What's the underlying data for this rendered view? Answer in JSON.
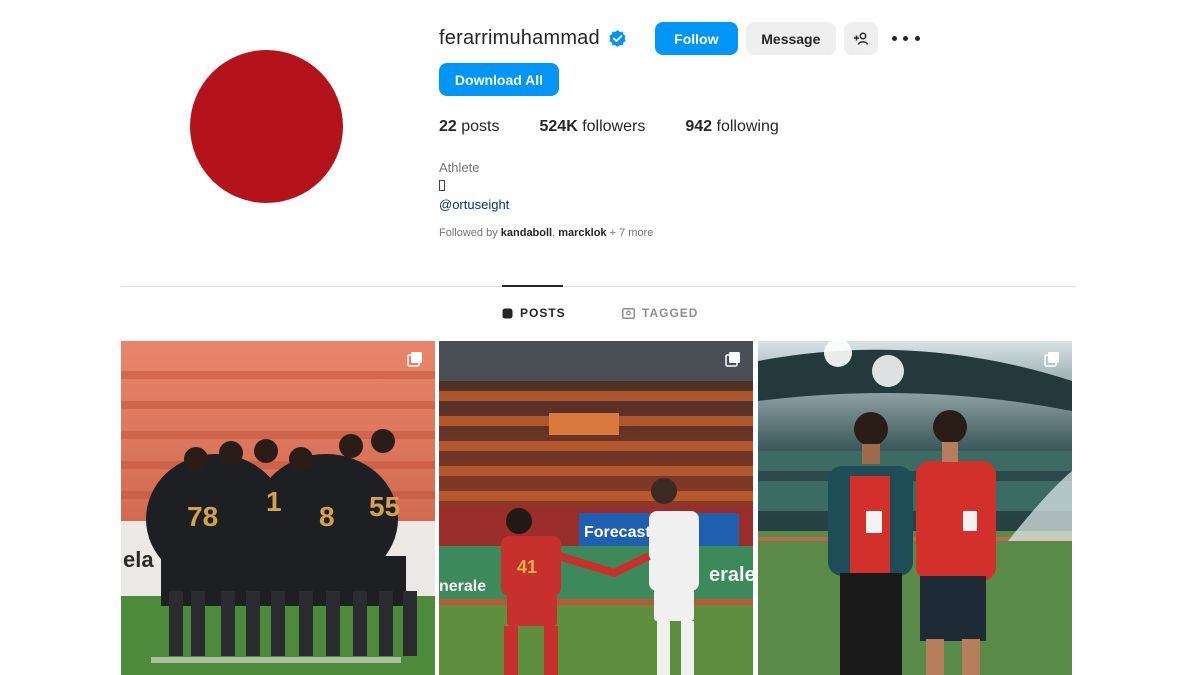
{
  "profile": {
    "username": "ferarrimuhammad",
    "verified_icon": "verified-badge-icon",
    "follow_label": "Follow",
    "message_label": "Message",
    "suggest_icon": "add-person-icon",
    "more_icon": "more-options-icon",
    "download_label": "Download All",
    "posts_count": "22",
    "posts_label": "posts",
    "followers_count": "524K",
    "followers_label": "followers",
    "following_count": "942",
    "following_label": "following",
    "bio_category": "Athlete",
    "bio_link": "@ortuseight",
    "followed_by_prefix": "Followed by",
    "followed_by_user1": "kandaboll",
    "followed_by_sep": ",",
    "followed_by_user2": "marcklok",
    "followed_by_more": "+ 7 more",
    "avatar_color": "#b5131c",
    "accent_color": "#0095f6"
  },
  "tabs": [
    {
      "label": "POSTS",
      "icon": "grid-icon",
      "active": true
    },
    {
      "label": "TAGGED",
      "icon": "tag-icon",
      "active": false
    }
  ],
  "posts": [
    {
      "description_icon": "multi-photo-icon",
      "jersey_numbers": [
        "78",
        "1",
        "8",
        "55"
      ]
    },
    {
      "description_icon": "multi-photo-icon",
      "jersey_numbers": [
        "41"
      ],
      "banner": "Forecastic",
      "sponsor": "erale"
    },
    {
      "description_icon": "multi-photo-icon"
    }
  ]
}
